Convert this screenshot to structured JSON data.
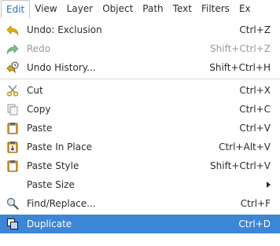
{
  "menubar": {
    "items": [
      "Edit",
      "View",
      "Layer",
      "Object",
      "Path",
      "Text",
      "Filters",
      "Ex"
    ]
  },
  "menu": {
    "items": [
      {
        "label": "Undo: Exclusion",
        "shortcut": "Ctrl+Z",
        "icon": "undo-icon"
      },
      {
        "label": "Redo",
        "shortcut": "Shift+Ctrl+Z",
        "icon": "redo-icon",
        "disabled": true
      },
      {
        "label": "Undo History...",
        "shortcut": "Shift+Ctrl+H",
        "icon": "undo-history-icon"
      },
      {
        "label": "Cut",
        "shortcut": "Ctrl+X",
        "icon": "scissors-icon"
      },
      {
        "label": "Copy",
        "shortcut": "Ctrl+C",
        "icon": "copy-icon"
      },
      {
        "label": "Paste",
        "shortcut": "Ctrl+V",
        "icon": "paste-icon"
      },
      {
        "label": "Paste In Place",
        "shortcut": "Ctrl+Alt+V",
        "icon": "paste-in-place-icon"
      },
      {
        "label": "Paste Style",
        "shortcut": "Shift+Ctrl+V",
        "icon": "paste-style-icon"
      },
      {
        "label": "Paste Size",
        "shortcut": "",
        "icon": "",
        "submenu": true
      },
      {
        "label": "Find/Replace...",
        "shortcut": "Ctrl+F",
        "icon": "magnifier-icon"
      },
      {
        "label": "Duplicate",
        "shortcut": "Ctrl+D",
        "icon": "duplicate-icon",
        "selected": true
      }
    ]
  },
  "colors": {
    "accent": "#3d86d6",
    "active_menu_text": "#2a6fc4",
    "disabled_text": "#9a9a9a"
  }
}
